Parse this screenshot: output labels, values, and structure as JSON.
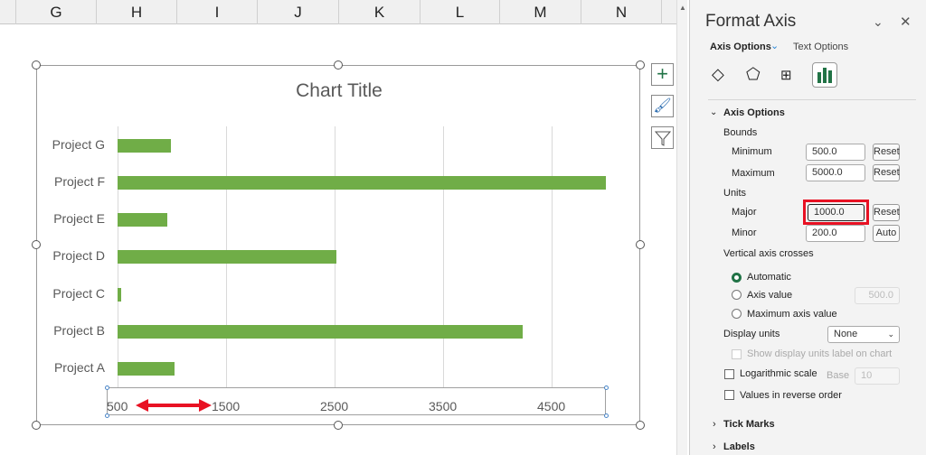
{
  "columns": [
    "G",
    "H",
    "I",
    "J",
    "K",
    "L",
    "M",
    "N"
  ],
  "chart": {
    "title": "Chart Title"
  },
  "chart_data": {
    "type": "bar",
    "orientation": "horizontal",
    "title": "Chart Title",
    "categories": [
      "Project A",
      "Project B",
      "Project C",
      "Project D",
      "Project E",
      "Project F",
      "Project G"
    ],
    "values": [
      1025,
      4230,
      530,
      2520,
      960,
      5000,
      990
    ],
    "xlim": [
      500,
      5000
    ],
    "ticks": [
      "500",
      "1500",
      "2500",
      "3500",
      "4500"
    ],
    "tick_values": [
      500,
      1500,
      2500,
      3500,
      4500
    ],
    "grid": true,
    "bar_color": "#70ad47"
  },
  "panel": {
    "title": "Format Axis",
    "tab_axis": "Axis Options",
    "tab_text": "Text Options",
    "section": "Axis Options",
    "bounds": "Bounds",
    "minimum_label": "Minimum",
    "minimum": "500.0",
    "maximum_label": "Maximum",
    "maximum": "5000.0",
    "units": "Units",
    "major_label": "Major",
    "major": "1000.0",
    "minor_label": "Minor",
    "minor": "200.0",
    "reset": "Reset",
    "auto": "Auto",
    "crosses": "Vertical axis crosses",
    "automatic": "Automatic",
    "axis_value": "Axis value",
    "axis_value_val": "500.0",
    "max_axis_value": "Maximum axis value",
    "display_units": "Display units",
    "display_units_val": "None",
    "show_units_label": "Show display units label on chart",
    "log_scale": "Logarithmic scale",
    "base": "Base",
    "base_val": "10",
    "reverse": "Values in reverse order",
    "tick_marks": "Tick Marks",
    "labels": "Labels"
  },
  "colors": {
    "highlight": "#e81123",
    "accent": "#217346"
  }
}
